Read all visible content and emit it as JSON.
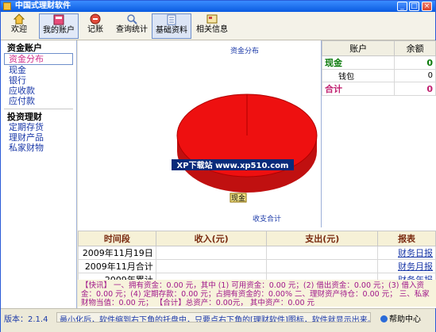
{
  "window": {
    "title": "中国式理财软件",
    "minimize": "_",
    "maximize": "□",
    "close": "×"
  },
  "toolbar": {
    "items": [
      {
        "label": "欢迎",
        "icon": "home-icon"
      },
      {
        "label": "我的账户",
        "icon": "ledger-icon"
      },
      {
        "label": "记账",
        "icon": "pen-icon"
      },
      {
        "label": "查询统计",
        "icon": "magnifier-icon"
      },
      {
        "label": "基础资料",
        "icon": "document-icon"
      },
      {
        "label": "相关信息",
        "icon": "info-card-icon"
      }
    ]
  },
  "sidebar": {
    "group1": "资金账户",
    "items1": [
      "资金分布",
      "现金",
      "银行",
      "应收款",
      "应付款"
    ],
    "group2": "投资理财",
    "items2": [
      "定期存货",
      "理财产品",
      "私家财物"
    ]
  },
  "chart": {
    "title": "资金分布",
    "slice_label": "现金",
    "watermark": "XP下载站 www.xp510.com",
    "footer_title": "收支合计"
  },
  "chart_data": {
    "type": "pie",
    "title": "资金分布",
    "categories": [
      "现金"
    ],
    "values": [
      100
    ]
  },
  "accounts": {
    "headers": [
      "账户",
      "余额"
    ],
    "rows": [
      {
        "name": "现金",
        "value": "0"
      },
      {
        "name": "钱包",
        "value": "0"
      },
      {
        "name": "合计",
        "value": "0"
      }
    ]
  },
  "summary": {
    "headers": [
      "时间段",
      "收入(元)",
      "支出(元)",
      "报表"
    ],
    "rows": [
      {
        "period": "2009年11月19日",
        "income": "",
        "expense": "",
        "report": "财务日报"
      },
      {
        "period": "2009年11月合计",
        "income": "",
        "expense": "",
        "report": "财务月报"
      },
      {
        "period": "2009年累计",
        "income": "",
        "expense": "",
        "report": "财务年报"
      }
    ]
  },
  "tips": {
    "text": "【快讯】 一、拥有资金：0.00 元，其中 (1) 可用资金：0.00 元；(2) 借出资金：0.00 元；(3) 借入资金：0.00 元；(4) 定期存款：0.00 元；占拥有资金的：0.00% 二、理财资产待仓：0.00 元； 三、私家财物当值：0.00 元； 【合计】总资产：0.00元， 其中资产：0.00 元"
  },
  "statusbar": {
    "version": "版本：2.1.4",
    "message": "最小化后，软件缩到右下角的托盘中，只要点右下角的[理财软件]图标，软件就显示出来。",
    "help": "帮助中心"
  }
}
